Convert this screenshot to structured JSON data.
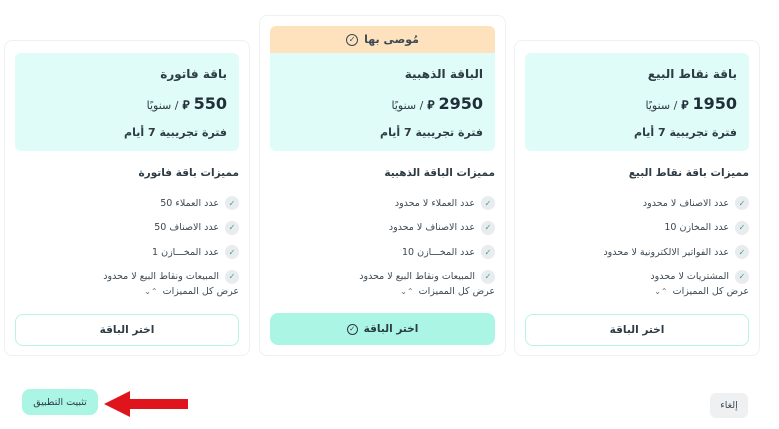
{
  "plans": [
    {
      "name": "باقة نقاط البيع",
      "price": "1950",
      "currency_symbol": "⃁",
      "period": "/ سنويًا",
      "trial": "فترة تجريبية 7 أيام",
      "features_title": "مميزات باقة نقاط البيع",
      "features": [
        "عدد الاصناف لا محدود",
        "عدد المخازن 10",
        "عدد الفواتير الالكترونية لا محدود",
        "المشتريات لا محدود"
      ],
      "show_all": "عرض كل المميزات",
      "select_label": "اختر الباقة"
    },
    {
      "name": "الباقة الذهبية",
      "price": "2950",
      "currency_symbol": "⃁",
      "period": "/ سنويًا",
      "trial": "فترة تجريبية 7 أيام",
      "badge": "مُوصى بها",
      "features_title": "مميزات الباقة الذهبية",
      "features": [
        "عدد العملاء لا محدود",
        "عدد الاصناف لا محدود",
        "عدد المخـــازن 10",
        "المبيعات ونقاط البيع لا محدود"
      ],
      "show_all": "عرض كل المميزات",
      "select_label": "اختر الباقة"
    },
    {
      "name": "باقة فاتورة",
      "price": "550",
      "currency_symbol": "⃁",
      "period": "/ سنويًا",
      "trial": "فترة تجريبية 7 أيام",
      "features_title": "مميزات باقة فاتورة",
      "features": [
        "عدد العملاء 50",
        "عدد الاصناف 50",
        "عدد المخـــازن 1",
        "المبيعات ونقاط البيع لا محدود"
      ],
      "show_all": "عرض كل المميزات",
      "select_label": "اختر الباقة"
    }
  ],
  "footer": {
    "install_label": "تثبيت التطبيق",
    "cancel_label": "إلغاء"
  },
  "colors": {
    "accent": "#aaf5e4",
    "header_bg": "#e0fcf8",
    "badge_bg": "#fde2bd",
    "arrow": "#e0141c"
  }
}
